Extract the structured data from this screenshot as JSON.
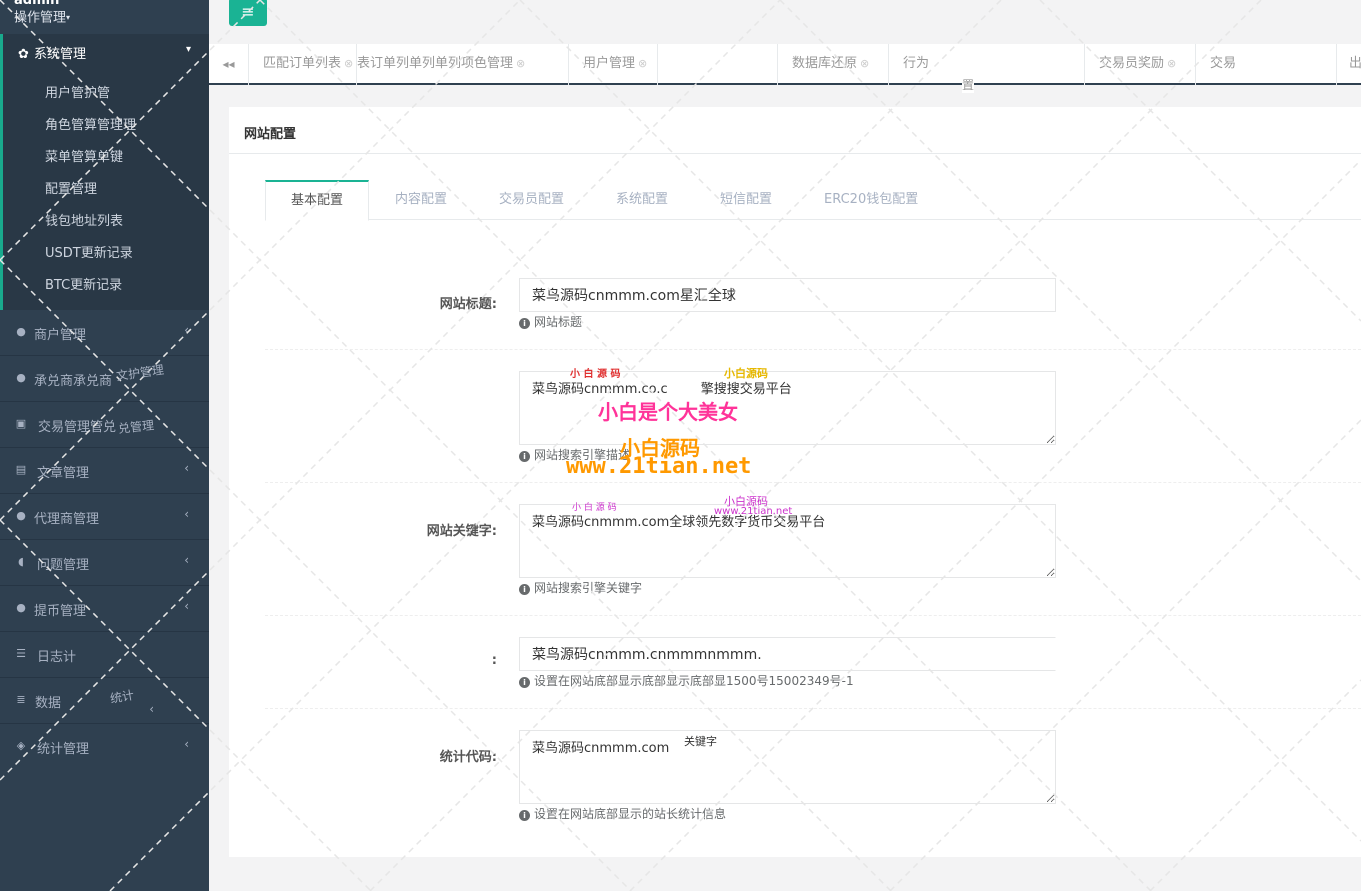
{
  "profile": {
    "username": "admin",
    "role": "操作管理",
    "caret": "▾"
  },
  "sidebar": {
    "active_group": {
      "label": "系统管理",
      "icon": "gear-icon",
      "chevron": "⌄"
    },
    "sub_items": [
      "用户管护管",
      "角色管算管理理",
      "菜单管算单键",
      "配置管理",
      "钱包地址列表",
      "USDT更新记录",
      "BTC更新记录"
    ],
    "items": [
      {
        "label": "商户管理",
        "icon": "user-icon"
      },
      {
        "label": "承兑商承兑商",
        "icon": "user-icon"
      },
      {
        "label": "交易管理管兑",
        "icon": "picture-icon"
      },
      {
        "label": "文章管理",
        "icon": "copy-icon"
      },
      {
        "label": "代理商管理",
        "icon": "user-icon"
      },
      {
        "label": "问题管理",
        "icon": "comment-icon"
      },
      {
        "label": "提币管理",
        "icon": "user-icon"
      },
      {
        "label": "日志计",
        "icon": "list-icon"
      },
      {
        "label": "数据",
        "icon": "database-icon"
      },
      {
        "label": "统计管理",
        "icon": "cube-icon"
      }
    ],
    "arrow": "‹"
  },
  "topbar": {
    "menu_icon": "≡"
  },
  "page_tabs": {
    "prev_icon": "◂◂",
    "tabs": [
      "匹配订单列表",
      "表订单列单列单列",
      "用户管理",
      "",
      "数据库还原",
      "行为",
      "交易员奖励",
      "交易"
    ],
    "close": "⊗",
    "right_label": "出"
  },
  "panel": {
    "title": "网站配置",
    "tabs": [
      "基本配置",
      "内容配置",
      "交易员配置",
      "系统配置",
      "短信配置",
      "ERC20钱包配置"
    ],
    "fields": [
      {
        "label": "网站标题:",
        "value": "菜鸟源码cnmmm.com星汇全球",
        "help": "网站标题"
      },
      {
        "label": "",
        "value": "菜鸟源码cnmmm.co.c        擎搜搜交易平台",
        "help": "网站搜索引擎描述"
      },
      {
        "label": "网站关键字:",
        "value": "菜鸟源码cnmmm.com全球领先数字货币交易平台",
        "help": "网站搜索引擎关键字"
      },
      {
        "label": ":",
        "value": "菜鸟源码cnmmm.cnmmmnmmm.",
        "help": "设置在网站底部显示底部显示底部显1500号15002349号-1"
      },
      {
        "label": "统计代码:",
        "value": "菜鸟源码cnmmm.com",
        "help": "设置在网站底部显示的站长统计信息"
      }
    ]
  },
  "watermarks": {
    "big_pink": "小白是个大美女",
    "orange_1": "小白源码",
    "orange_2": "www.21tian.net",
    "small_red": "小 白 源 码",
    "small_yellow": "小白源码",
    "small_purple": "小白源码",
    "small_purple_url": "www.21tian.net",
    "keyword_fragment": "关键字",
    "tab_fragment_1": "理",
    "tab_fragment_2": "置",
    "side_fragment_1": "文护管理",
    "side_fragment_2": "兑管理",
    "side_fragment_3": "统计"
  },
  "colors": {
    "sidebar": "#2f4050",
    "accent": "#1ab394",
    "pink": "#ff3399",
    "orange": "#ff9900"
  }
}
